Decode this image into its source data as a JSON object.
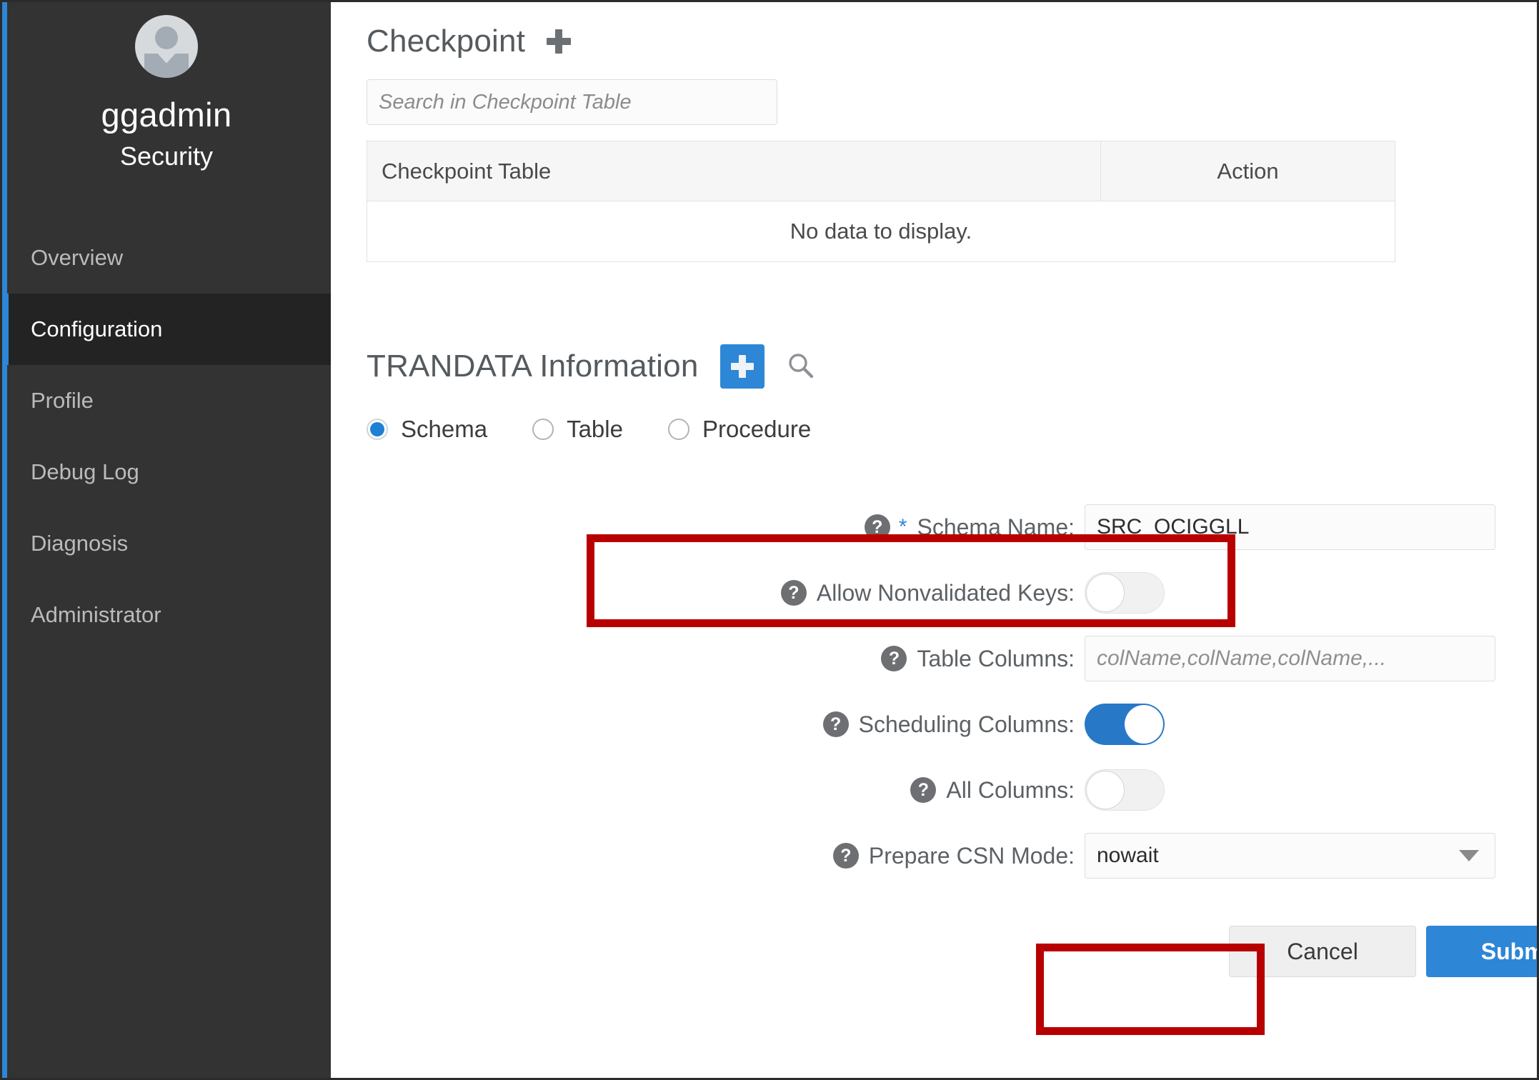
{
  "theme": {
    "accent_blue": "#2e86d6",
    "sidebar_bg": "#333333",
    "sidebar_active_bg": "#232323",
    "toggle_on": "#2878c8",
    "annotation_red": "#b80000"
  },
  "sidebar": {
    "avatar_icon": "user-avatar-icon",
    "user_name": "ggadmin",
    "user_role": "Security",
    "items": [
      {
        "label": "Overview",
        "active": false
      },
      {
        "label": "Configuration",
        "active": true
      },
      {
        "label": "Profile",
        "active": false
      },
      {
        "label": "Debug Log",
        "active": false
      },
      {
        "label": "Diagnosis",
        "active": false
      },
      {
        "label": "Administrator",
        "active": false
      }
    ]
  },
  "checkpoint": {
    "title": "Checkpoint",
    "add_icon": "plus-icon",
    "search": {
      "placeholder": "Search in Checkpoint Table",
      "value": ""
    },
    "table": {
      "columns": [
        "Checkpoint Table",
        "Action"
      ],
      "rows": [],
      "empty_message": "No data to display."
    }
  },
  "trandata": {
    "title": "TRANDATA Information",
    "add_icon": "plus-icon",
    "search_icon": "search-icon",
    "radio_group": {
      "selected": "Schema",
      "options": [
        {
          "label": "Schema",
          "selected": true
        },
        {
          "label": "Table",
          "selected": false
        },
        {
          "label": "Procedure",
          "selected": false
        }
      ]
    },
    "fields": {
      "schema_name": {
        "label": "Schema Name:",
        "required_marker": "*",
        "help_icon": "help-circle-icon",
        "value": "SRC_OCIGGLL",
        "placeholder": ""
      },
      "allow_nonvalidated_keys": {
        "label": "Allow Nonvalidated Keys:",
        "help_icon": "help-circle-icon",
        "state": "off"
      },
      "table_columns": {
        "label": "Table Columns:",
        "help_icon": "help-circle-icon",
        "value": "",
        "placeholder": "colName,colName,colName,..."
      },
      "scheduling_columns": {
        "label": "Scheduling Columns:",
        "help_icon": "help-circle-icon",
        "state": "on"
      },
      "all_columns": {
        "label": "All Columns:",
        "help_icon": "help-circle-icon",
        "state": "off"
      },
      "prepare_csn_mode": {
        "label": "Prepare CSN Mode:",
        "help_icon": "help-circle-icon",
        "value": "nowait",
        "caret_icon": "chevron-down-icon"
      }
    },
    "buttons": {
      "cancel": "Cancel",
      "submit": "Submit"
    }
  }
}
